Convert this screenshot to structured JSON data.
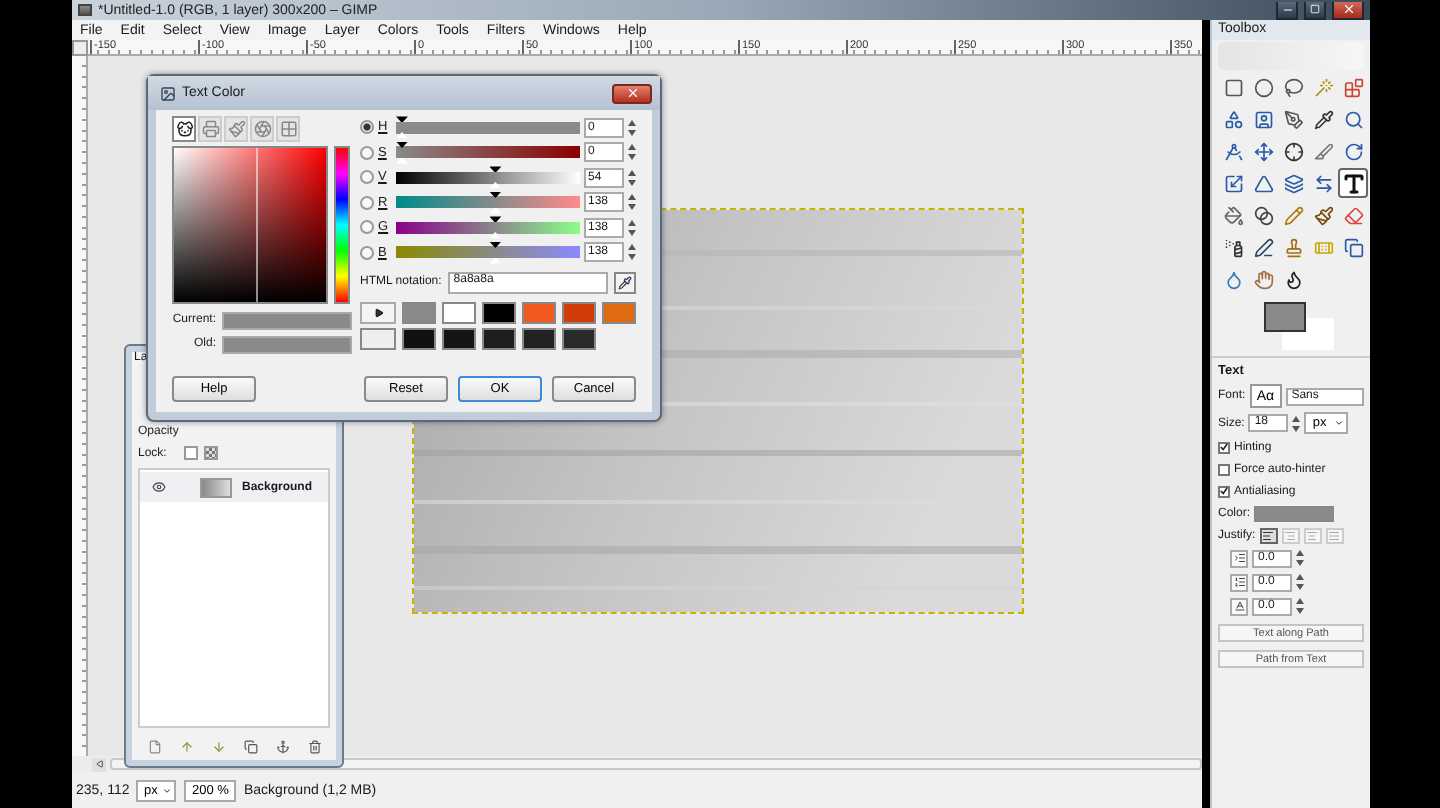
{
  "main_window": {
    "title": "*Untitled-1.0 (RGB, 1 layer) 300x200 – GIMP",
    "menu": [
      "File",
      "Edit",
      "Select",
      "View",
      "Image",
      "Layer",
      "Colors",
      "Tools",
      "Filters",
      "Windows",
      "Help"
    ],
    "ruler_labels": [
      "-150",
      "-100",
      "-50",
      "0",
      "50",
      "100",
      "150",
      "200",
      "250",
      "300",
      "350"
    ],
    "status": {
      "coords": "235, 112",
      "unit": "px",
      "zoom": "200 %",
      "info": "Background (1,2 MB)"
    }
  },
  "layers_dialog": {
    "tab": "La",
    "opacity_label": "Opacity",
    "lock_label": "Lock:",
    "locks": [
      {
        "checked": false
      }
    ],
    "layers": [
      {
        "name": "Background",
        "selected": true
      }
    ]
  },
  "color_dialog": {
    "title": "Text Color",
    "tabs": [
      {
        "selected": true
      },
      {
        "selected": false
      },
      {
        "selected": false
      },
      {
        "selected": false
      },
      {
        "selected": false
      }
    ],
    "current": {
      "label": "Current:",
      "color": "#8a8a8a"
    },
    "old": {
      "label": "Old:",
      "color": "#8a8a8a"
    },
    "channels": [
      {
        "letter": "H",
        "selected": true,
        "level": 0,
        "value": "0"
      },
      {
        "letter": "S",
        "selected": false,
        "level": 0,
        "value": "0"
      },
      {
        "letter": "V",
        "selected": false,
        "level": 0.54,
        "value": "54"
      },
      {
        "letter": "R",
        "selected": false,
        "level": 0.54,
        "value": "138"
      },
      {
        "letter": "G",
        "selected": false,
        "level": 0.54,
        "value": "138"
      },
      {
        "letter": "B",
        "selected": false,
        "level": 0.54,
        "value": "138"
      }
    ],
    "html_label": "HTML notation:",
    "html_value": "8a8a8a",
    "history": [
      {
        "color": "#8a8a8a"
      },
      {
        "color": "#ffffff"
      },
      {
        "color": "#000000"
      },
      {
        "color": "#f05a1e"
      },
      {
        "color": "#d23c0a"
      },
      {
        "color": "#e06a14"
      },
      {
        "color": "#eeeeee"
      },
      {
        "color": "#111111"
      },
      {
        "color": "#151515"
      },
      {
        "color": "#1e1e1e"
      },
      {
        "color": "#222222"
      },
      {
        "color": "#2a2a2a"
      }
    ],
    "buttons": [
      "Help",
      "Reset",
      "OK",
      "Cancel"
    ]
  },
  "toolbox": {
    "title": "Toolbox",
    "tools": [
      {
        "selected": false
      },
      {
        "selected": false
      },
      {
        "selected": false
      },
      {
        "selected": false
      },
      {
        "selected": false
      },
      {
        "selected": false
      },
      {
        "selected": false
      },
      {
        "selected": false
      },
      {
        "selected": false
      },
      {
        "selected": false
      },
      {
        "selected": false
      },
      {
        "selected": false
      },
      {
        "selected": false
      },
      {
        "selected": false
      },
      {
        "selected": false
      },
      {
        "selected": false
      },
      {
        "selected": false
      },
      {
        "selected": false
      },
      {
        "selected": false
      },
      {
        "selected": true
      },
      {
        "selected": false
      },
      {
        "selected": false
      },
      {
        "selected": false
      },
      {
        "selected": false
      },
      {
        "selected": false
      },
      {
        "selected": false
      },
      {
        "selected": false
      },
      {
        "selected": false
      },
      {
        "selected": false
      },
      {
        "selected": false
      },
      {
        "selected": false
      },
      {
        "selected": false
      },
      {
        "selected": false
      }
    ],
    "options": {
      "title": "Text",
      "font_label": "Font:",
      "font_preview": "Aα",
      "font": "Sans",
      "size_label": "Size:",
      "size": "18",
      "unit": "px",
      "checks": [
        {
          "label": "Hinting",
          "checked": true
        },
        {
          "label": "Force auto-hinter",
          "checked": false
        },
        {
          "label": "Antialiasing",
          "checked": true
        }
      ],
      "color_label": "Color:",
      "color": "#8a8a8a",
      "foreground": {
        "color": "#8a8a8a"
      },
      "justify_label": "Justify:",
      "justify": [
        {
          "selected": true
        },
        {
          "selected": false
        },
        {
          "selected": false
        },
        {
          "selected": false
        }
      ],
      "spins": [
        "0.0",
        "0.0",
        "0.0"
      ],
      "buttons": [
        "Text along Path",
        "Path from Text"
      ]
    }
  }
}
